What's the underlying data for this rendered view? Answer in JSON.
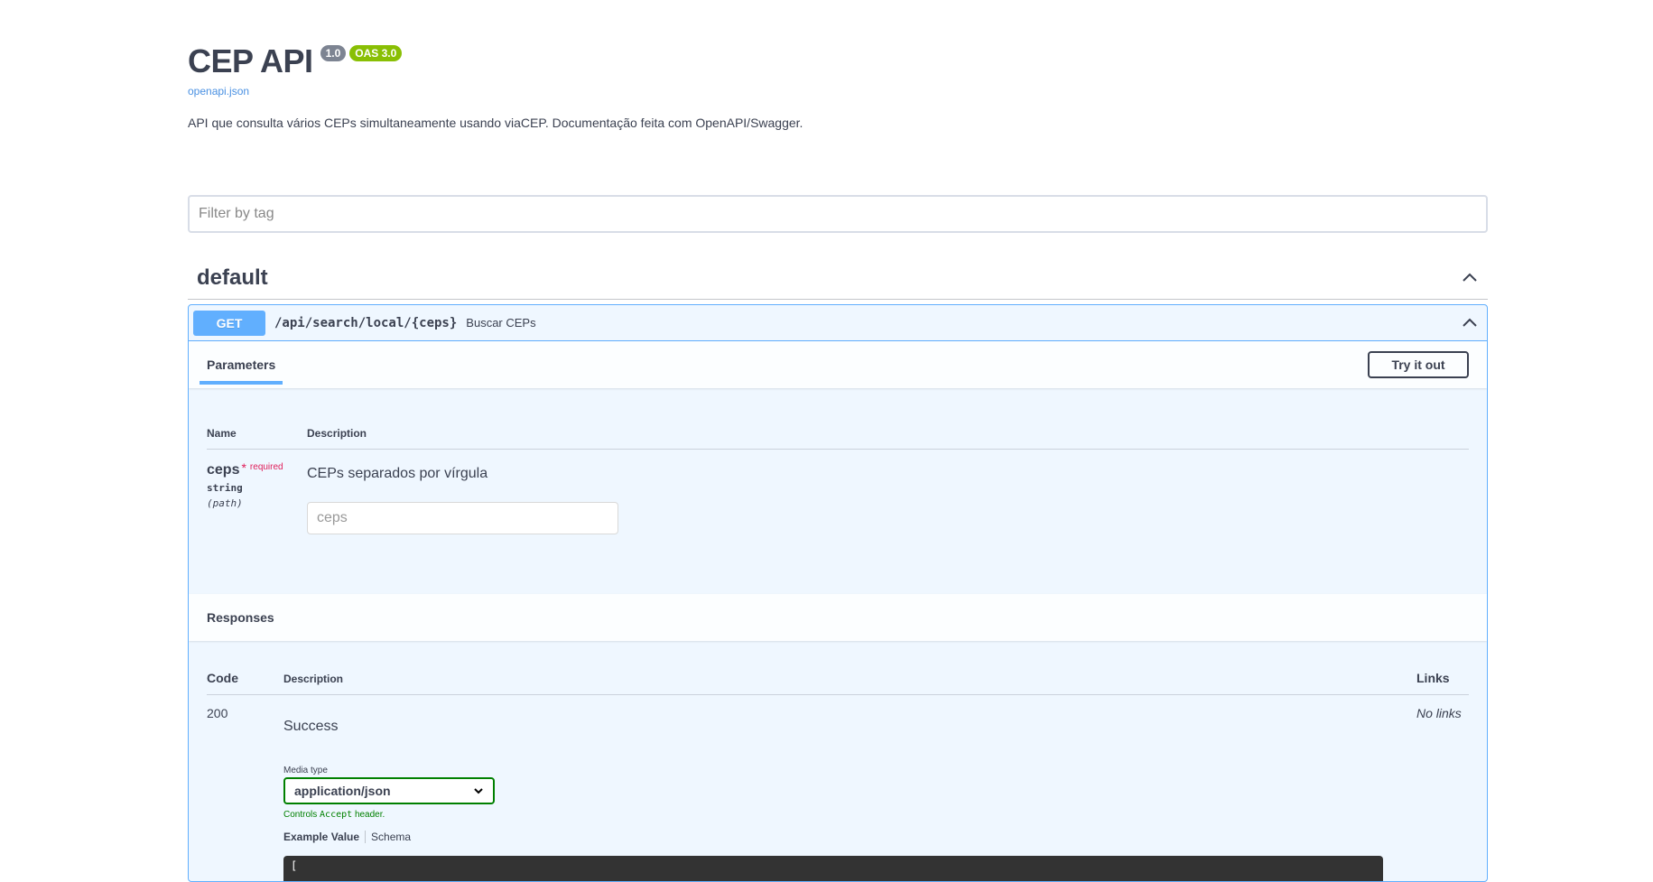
{
  "info": {
    "title": "CEP API",
    "version": "1.0",
    "oas": "OAS 3.0",
    "spec_link": "openapi.json",
    "description": "API que consulta vários CEPs simultaneamente usando viaCEP. Documentação feita com OpenAPI/Swagger."
  },
  "filter": {
    "placeholder": "Filter by tag"
  },
  "tag": {
    "name": "default"
  },
  "operation": {
    "method": "GET",
    "path": "/api/search/local/{ceps}",
    "summary": "Buscar CEPs",
    "parameters_tab": "Parameters",
    "try_button": "Try it out",
    "param_headers": {
      "name": "Name",
      "description": "Description"
    },
    "parameter": {
      "name": "ceps",
      "required_mark": "*",
      "required_text": "required",
      "type": "string",
      "location": "(path)",
      "description": "CEPs separados por vírgula",
      "placeholder": "ceps"
    },
    "responses": {
      "title": "Responses",
      "headers": {
        "code": "Code",
        "description": "Description",
        "links": "Links"
      },
      "rows": [
        {
          "code": "200",
          "description": "Success",
          "links": "No links",
          "media_label": "Media type",
          "media_value": "application/json",
          "controls_prefix": "Controls",
          "controls_code": "Accept",
          "controls_suffix": "header.",
          "example_tab": "Example Value",
          "schema_tab": "Schema",
          "example_start": "["
        }
      ]
    }
  },
  "colors": {
    "get": "#61affe",
    "oas_badge": "#89bf04",
    "version_badge": "#7d8492",
    "text": "#3b4151",
    "required": "#e01e5a",
    "controls": "#008000"
  }
}
